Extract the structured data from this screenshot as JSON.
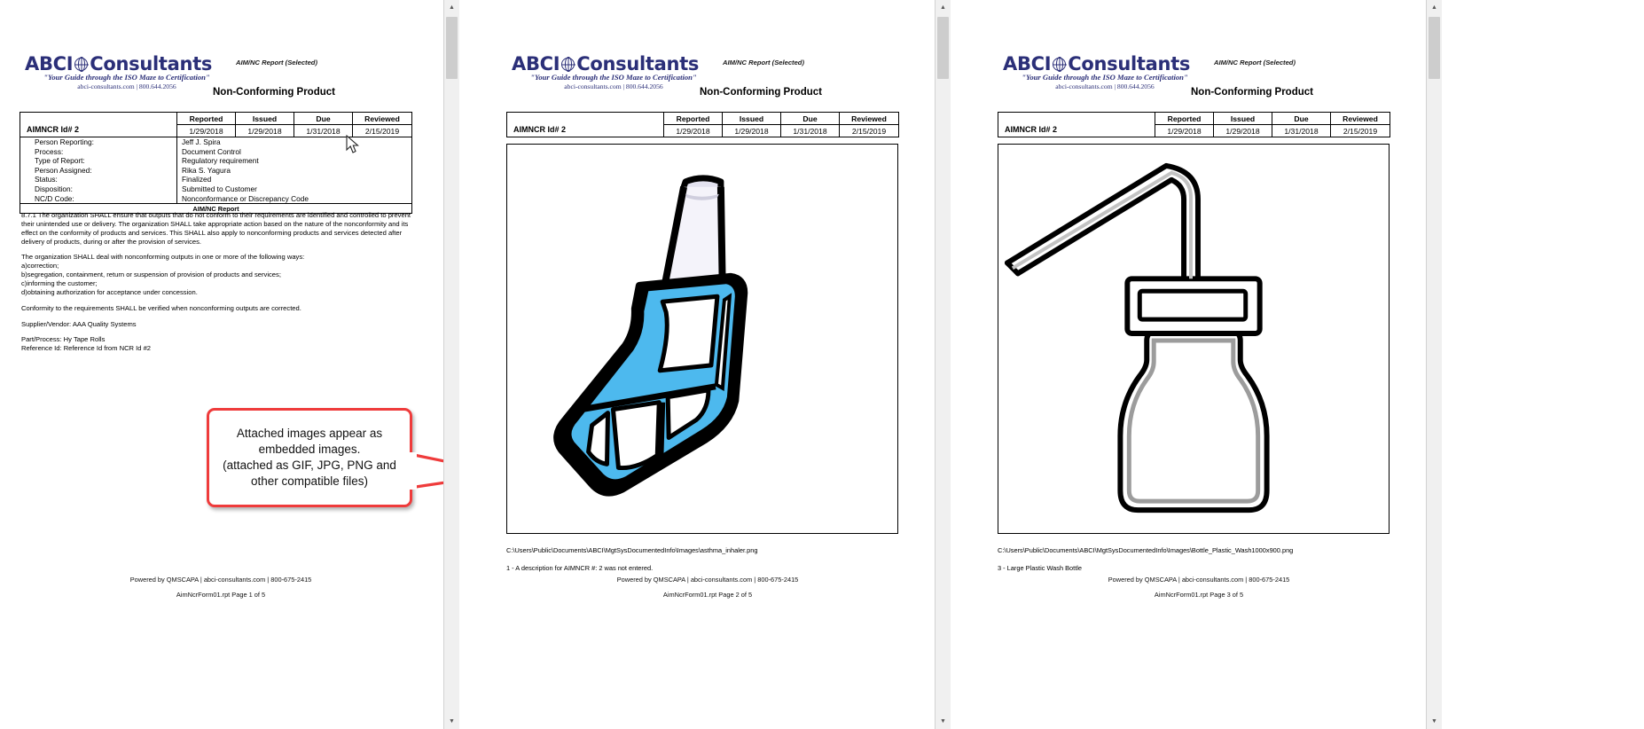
{
  "brand": {
    "logo_text_left": "ABCI",
    "logo_icon": "globe-icon",
    "logo_text_right": "Consultants",
    "tagline": "\"Your Guide through the ISO Maze to Certification\"",
    "contact": "abci-consultants.com | 800.644.2056",
    "accent_color": "#2b2f78"
  },
  "report": {
    "kind_label": "AIM/NC Report (Selected)",
    "title": "Non-Conforming Product",
    "band_label": "AIM/NC Report"
  },
  "record": {
    "id_label": "AIMNCR Id# 2",
    "columns": [
      "Reported",
      "Issued",
      "Due",
      "Reviewed"
    ],
    "dates": [
      "1/29/2018",
      "1/29/2018",
      "1/31/2018",
      "2/15/2019"
    ],
    "details": [
      {
        "label": "Person Reporting:",
        "value": "Jeff J. Spira"
      },
      {
        "label": "Process:",
        "value": "Document Control"
      },
      {
        "label": "Type of Report:",
        "value": "Regulatory requirement"
      },
      {
        "label": "Person Assigned:",
        "value": "Rika S. Yagura"
      },
      {
        "label": "Status:",
        "value": "Finalized"
      },
      {
        "label": "Disposition:",
        "value": "Submitted to Customer"
      },
      {
        "label": "NC/D Code:",
        "value": "Nonconformance or Discrepancy Code"
      }
    ]
  },
  "clause": {
    "para1": "8.7.1 The organization SHALL ensure that outputs that do not conform to their requirements are identified and controlled to prevent their unintended use or delivery. The organization SHALL take appropriate action based on the nature of the nonconformity and its effect on the conformity of products and services. This SHALL also apply to nonconforming products and services detected after delivery of products, during or after the provision of services.",
    "para2_intro": "The organization SHALL deal with nonconforming outputs in one or more of the following ways:",
    "list": [
      "a)correction;",
      "b)segregation, containment, return or suspension of provision of products and services;",
      "c)informing the customer;",
      "d)obtaining authorization for acceptance under concession."
    ],
    "para3": "Conformity to the requirements SHALL be verified when nonconforming outputs are corrected.",
    "supplier": "Supplier/Vendor: AAA Quality Systems",
    "part_process": "Part/Process: Hy Tape Rolls",
    "reference_id": "Reference Id: Reference Id from NCR Id #2"
  },
  "callout": {
    "text": "Attached images appear as embedded images.\n(attached as GIF, JPG, PNG and other compatible files)",
    "border_color": "#ef3b3b"
  },
  "pages": [
    {
      "number": 1,
      "footer_powered": "Powered by QMSCAPA | abci-consultants.com | 800-675-2415",
      "footer_page": "AimNcrForm01.rpt Page 1 of 5"
    },
    {
      "number": 2,
      "image_name": "asthma-inhaler-image",
      "caption_path": "C:\\Users\\Public\\Documents\\ABCI\\MgtSysDocumentedInfo\\Images\\asthma_inhaler.png",
      "caption_desc": "1 - A description for AIMNCR #: 2 was not entered.",
      "footer_powered": "Powered by QMSCAPA | abci-consultants.com | 800-675-2415",
      "footer_page": "AimNcrForm01.rpt Page 2 of 5"
    },
    {
      "number": 3,
      "image_name": "plastic-wash-bottle-image",
      "caption_path": "C:\\Users\\Public\\Documents\\ABCI\\MgtSysDocumentedInfo\\Images\\Bottle_Plastic_Wash1000x900.png",
      "caption_desc": "3 - Large Plastic Wash Bottle",
      "footer_powered": "Powered by QMSCAPA | abci-consultants.com | 800-675-2415",
      "footer_page": "AimNcrForm01.rpt Page 3 of 5"
    }
  ],
  "scrollbars": {
    "up_arrow": "▲",
    "down_arrow": "▼"
  }
}
